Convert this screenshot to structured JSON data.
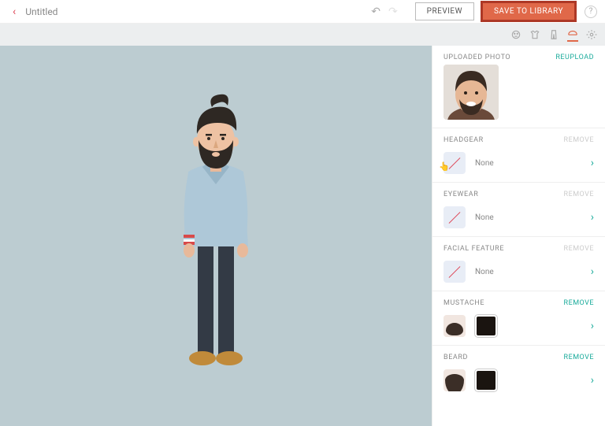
{
  "header": {
    "title": "Untitled",
    "preview_label": "PREVIEW",
    "save_label": "SAVE TO LIBRARY"
  },
  "tabs": {
    "active": "headgear"
  },
  "panel": {
    "uploaded_label": "UPLOADED PHOTO",
    "reupload_label": "REUPLOAD",
    "sections": [
      {
        "id": "headgear",
        "label": "HEADGEAR",
        "action": "REMOVE",
        "action_enabled": false,
        "value": "None",
        "style": "none"
      },
      {
        "id": "eyewear",
        "label": "EYEWEAR",
        "action": "REMOVE",
        "action_enabled": false,
        "value": "None",
        "style": "none"
      },
      {
        "id": "facial_feature",
        "label": "FACIAL FEATURE",
        "action": "REMOVE",
        "action_enabled": false,
        "value": "None",
        "style": "none"
      },
      {
        "id": "mustache",
        "label": "MUSTACHE",
        "action": "REMOVE",
        "action_enabled": true,
        "value": "",
        "style": "mustache",
        "color": "#1a1410"
      },
      {
        "id": "beard",
        "label": "BEARD",
        "action": "REMOVE",
        "action_enabled": true,
        "value": "",
        "style": "beard",
        "color": "#1a1410"
      }
    ]
  }
}
